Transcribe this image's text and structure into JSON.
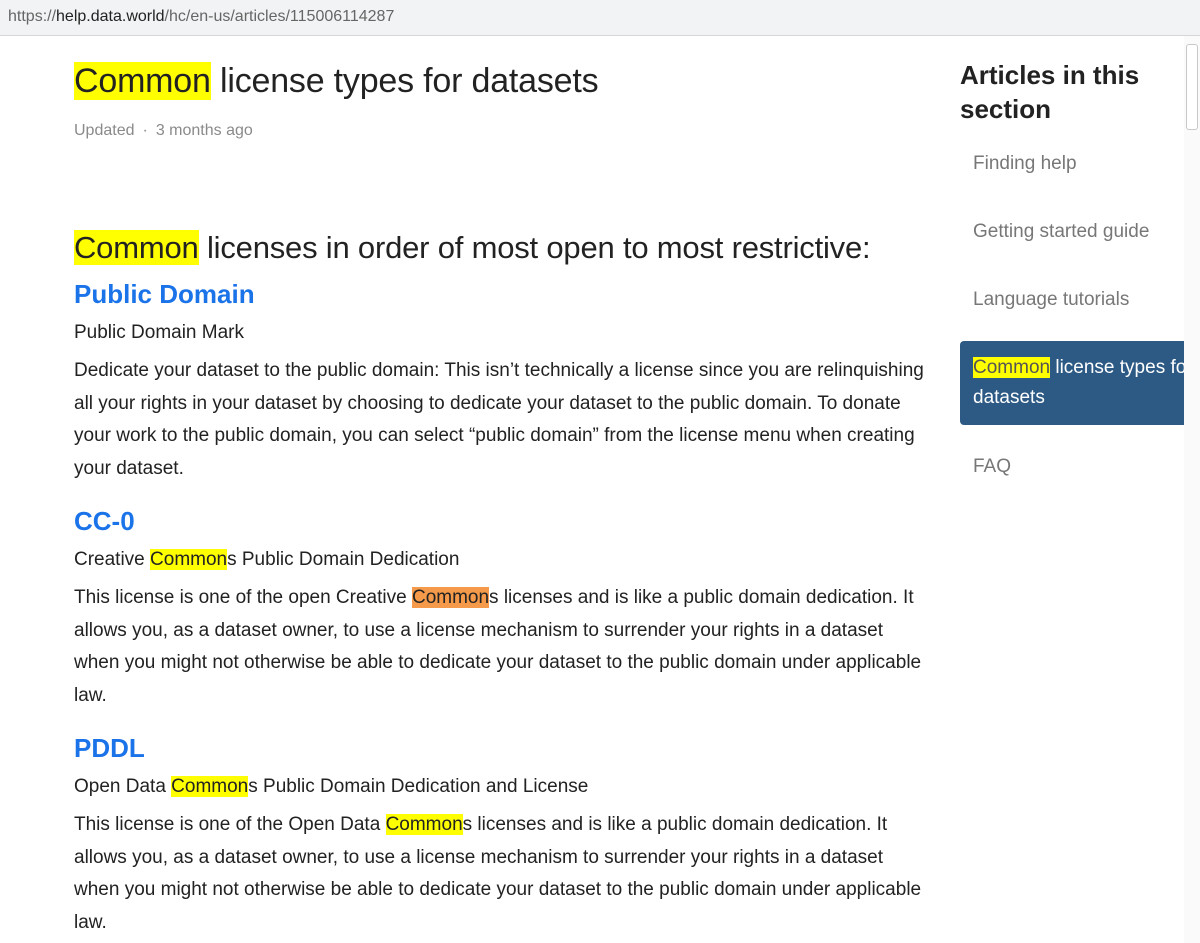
{
  "browser": {
    "url_prefix": "https://",
    "url_host": "help.data.world",
    "url_path": "/hc/en-us/articles/115006114287"
  },
  "article": {
    "title_highlight": "Common",
    "title_rest": " license types for datasets",
    "updated_label": "Updated",
    "separator": "·",
    "updated_time": "3 months ago",
    "subheading_highlight": "Common",
    "subheading_rest": " licenses in order of most open to most restrictive:",
    "sections": [
      {
        "title": "Public Domain",
        "subtitle": "Public Domain Mark",
        "body": "Dedicate your dataset to the public domain: This isn’t technically a license since you are relinquishing all your rights in your dataset by choosing to dedicate your dataset to the public domain. To donate your work to the public domain, you can select “public domain” from the license menu when creating your dataset."
      },
      {
        "title": "CC-0",
        "subtitle_pre": "Creative ",
        "subtitle_hl": "Common",
        "subtitle_post": "s Public Domain Dedication",
        "body_pre": "This license is one of the open Creative ",
        "body_hl": "Common",
        "body_post": "s licenses and is like a public domain dedication. It allows you, as a dataset owner, to use a license mechanism to surrender your rights in a dataset when you might not otherwise be able to dedicate your dataset to the public domain under applicable law."
      },
      {
        "title": "PDDL",
        "subtitle_pre": "Open Data ",
        "subtitle_hl": "Common",
        "subtitle_post": "s Public Domain Dedication and License",
        "body_pre": "This license is one of the Open Data ",
        "body_hl": "Common",
        "body_post": "s licenses and is like a public domain dedication. It allows you, as a dataset owner, to use a license mechanism to surrender your rights in a dataset when you might not otherwise be able to dedicate your dataset to the public domain under applicable law."
      }
    ]
  },
  "sidebar": {
    "heading": "Articles in this section",
    "items": [
      {
        "label": "Finding help"
      },
      {
        "label": "Getting started guide"
      },
      {
        "label": "Language tutorials"
      },
      {
        "label_hl": "Common",
        "label_rest": " license types for datasets",
        "active": true
      },
      {
        "label": "FAQ"
      }
    ]
  },
  "colors": {
    "link_blue": "#1a73e8",
    "highlight": "#ffff00",
    "highlight_active": "#f49a4a",
    "active_nav_bg": "#2d5a85"
  }
}
